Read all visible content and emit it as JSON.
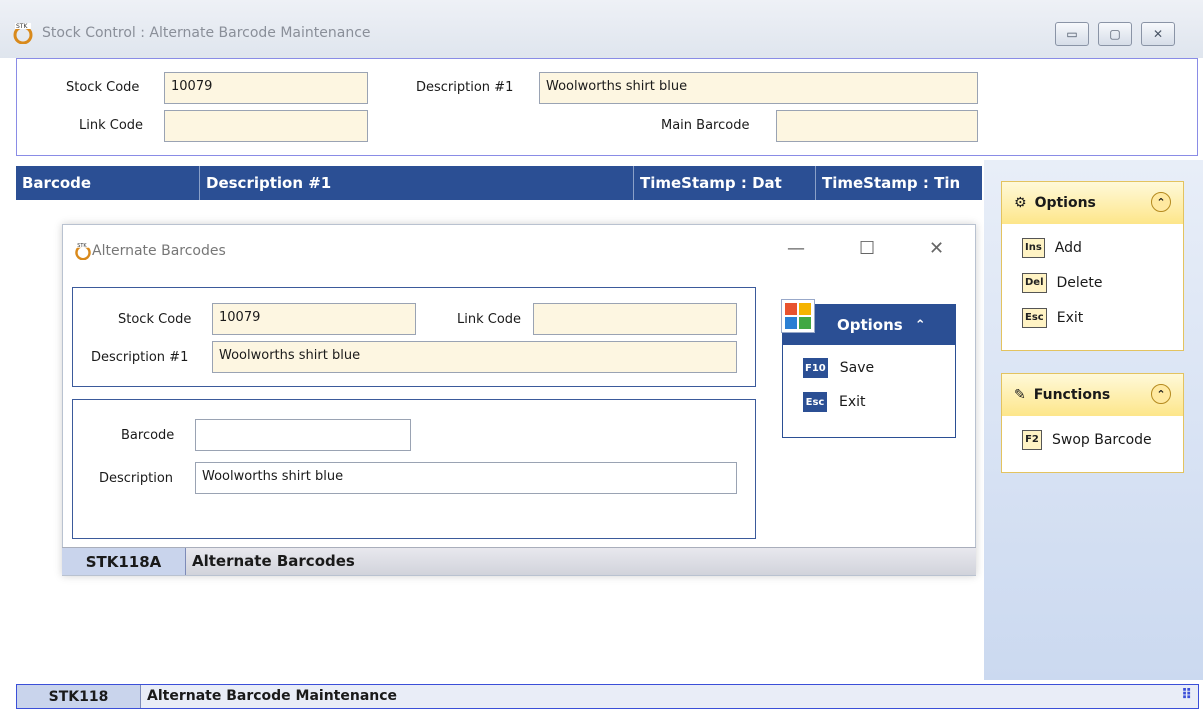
{
  "window": {
    "title": "Stock Control : Alternate Barcode Maintenance",
    "controls": {
      "minimize": "▭",
      "maximize": "▢",
      "close": "✕"
    }
  },
  "header": {
    "stock_code_label": "Stock Code",
    "stock_code_value": "10079",
    "description_label": "Description #1",
    "description_value": "Woolworths shirt blue",
    "link_code_label": "Link Code",
    "link_code_value": "",
    "main_barcode_label": "Main Barcode",
    "main_barcode_value": ""
  },
  "grid": {
    "columns": [
      "Barcode",
      "Description #1",
      "TimeStamp : Dat",
      "TimeStamp : Tin"
    ]
  },
  "side_options": {
    "title": "Options",
    "items": [
      {
        "key": "Ins",
        "label": "Add"
      },
      {
        "key": "Del",
        "label": "Delete"
      },
      {
        "key": "Esc",
        "label": "Exit"
      }
    ]
  },
  "side_functions": {
    "title": "Functions",
    "items": [
      {
        "key": "F2",
        "label": "Swop Barcode"
      }
    ]
  },
  "dialog": {
    "title": "Alternate Barcodes",
    "controls": {
      "minimize": "—",
      "maximize": "☐",
      "close": "✕"
    },
    "stock_code_label": "Stock Code",
    "stock_code_value": "10079",
    "link_code_label": "Link Code",
    "link_code_value": "",
    "description_label": "Description #1",
    "description_value": "Woolworths shirt blue",
    "barcode_label": "Barcode",
    "barcode_value": "",
    "desc_label": "Description",
    "desc_value": "Woolworths shirt blue",
    "options": {
      "title": "Options",
      "collapse": "≈",
      "items": [
        {
          "key": "F10",
          "label": "Save"
        },
        {
          "key": "Esc",
          "label": "Exit"
        }
      ]
    },
    "status": {
      "code": "STK118A",
      "text": "Alternate Barcodes"
    }
  },
  "status": {
    "code": "STK118",
    "text": "Alternate Barcode Maintenance"
  },
  "colors": {
    "grid_header": "#2b4f94",
    "field_bg": "#fdf6e1",
    "side_header": "#fde68a",
    "status_border": "#3b4fd8"
  }
}
